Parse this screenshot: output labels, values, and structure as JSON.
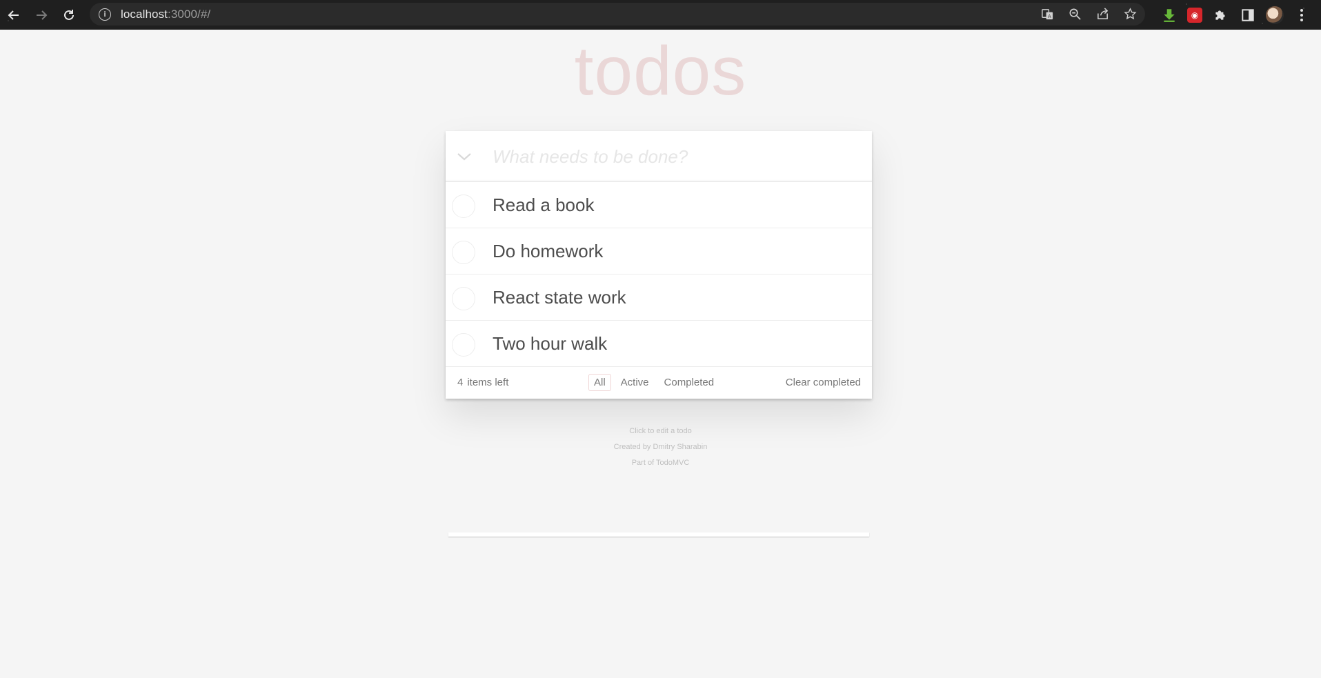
{
  "browser": {
    "url_host": "localhost",
    "url_rest": ":3000/#/",
    "icons": [
      "back-icon",
      "forward-icon",
      "reload-icon",
      "info-icon",
      "translate-icon",
      "zoom-icon",
      "share-icon",
      "bookmark-star-icon",
      "download-extension-icon",
      "red-extension-icon",
      "puzzle-extensions-icon",
      "side-panel-icon",
      "profile-avatar",
      "menu-kebab-icon"
    ]
  },
  "app": {
    "title": "todos",
    "new_todo_placeholder": "What needs to be done?",
    "todos": [
      {
        "label": "Read a book",
        "completed": false
      },
      {
        "label": "Do homework",
        "completed": false
      },
      {
        "label": "React state work",
        "completed": false
      },
      {
        "label": "Two hour walk",
        "completed": false
      }
    ],
    "footer": {
      "count": "4",
      "count_suffix": "items left",
      "filters": [
        "All",
        "Active",
        "Completed"
      ],
      "selected_filter": "All",
      "clear_label": "Clear completed"
    }
  },
  "info": {
    "line1": "Click to edit a todo",
    "line2": "Created by Dmitry Sharabin",
    "line3": "Part of TodoMVC"
  },
  "colors": {
    "title": "#ecd7d7",
    "background": "#f5f5f5",
    "text": "#4d4d4d",
    "chrome": "#1f1f1f"
  }
}
